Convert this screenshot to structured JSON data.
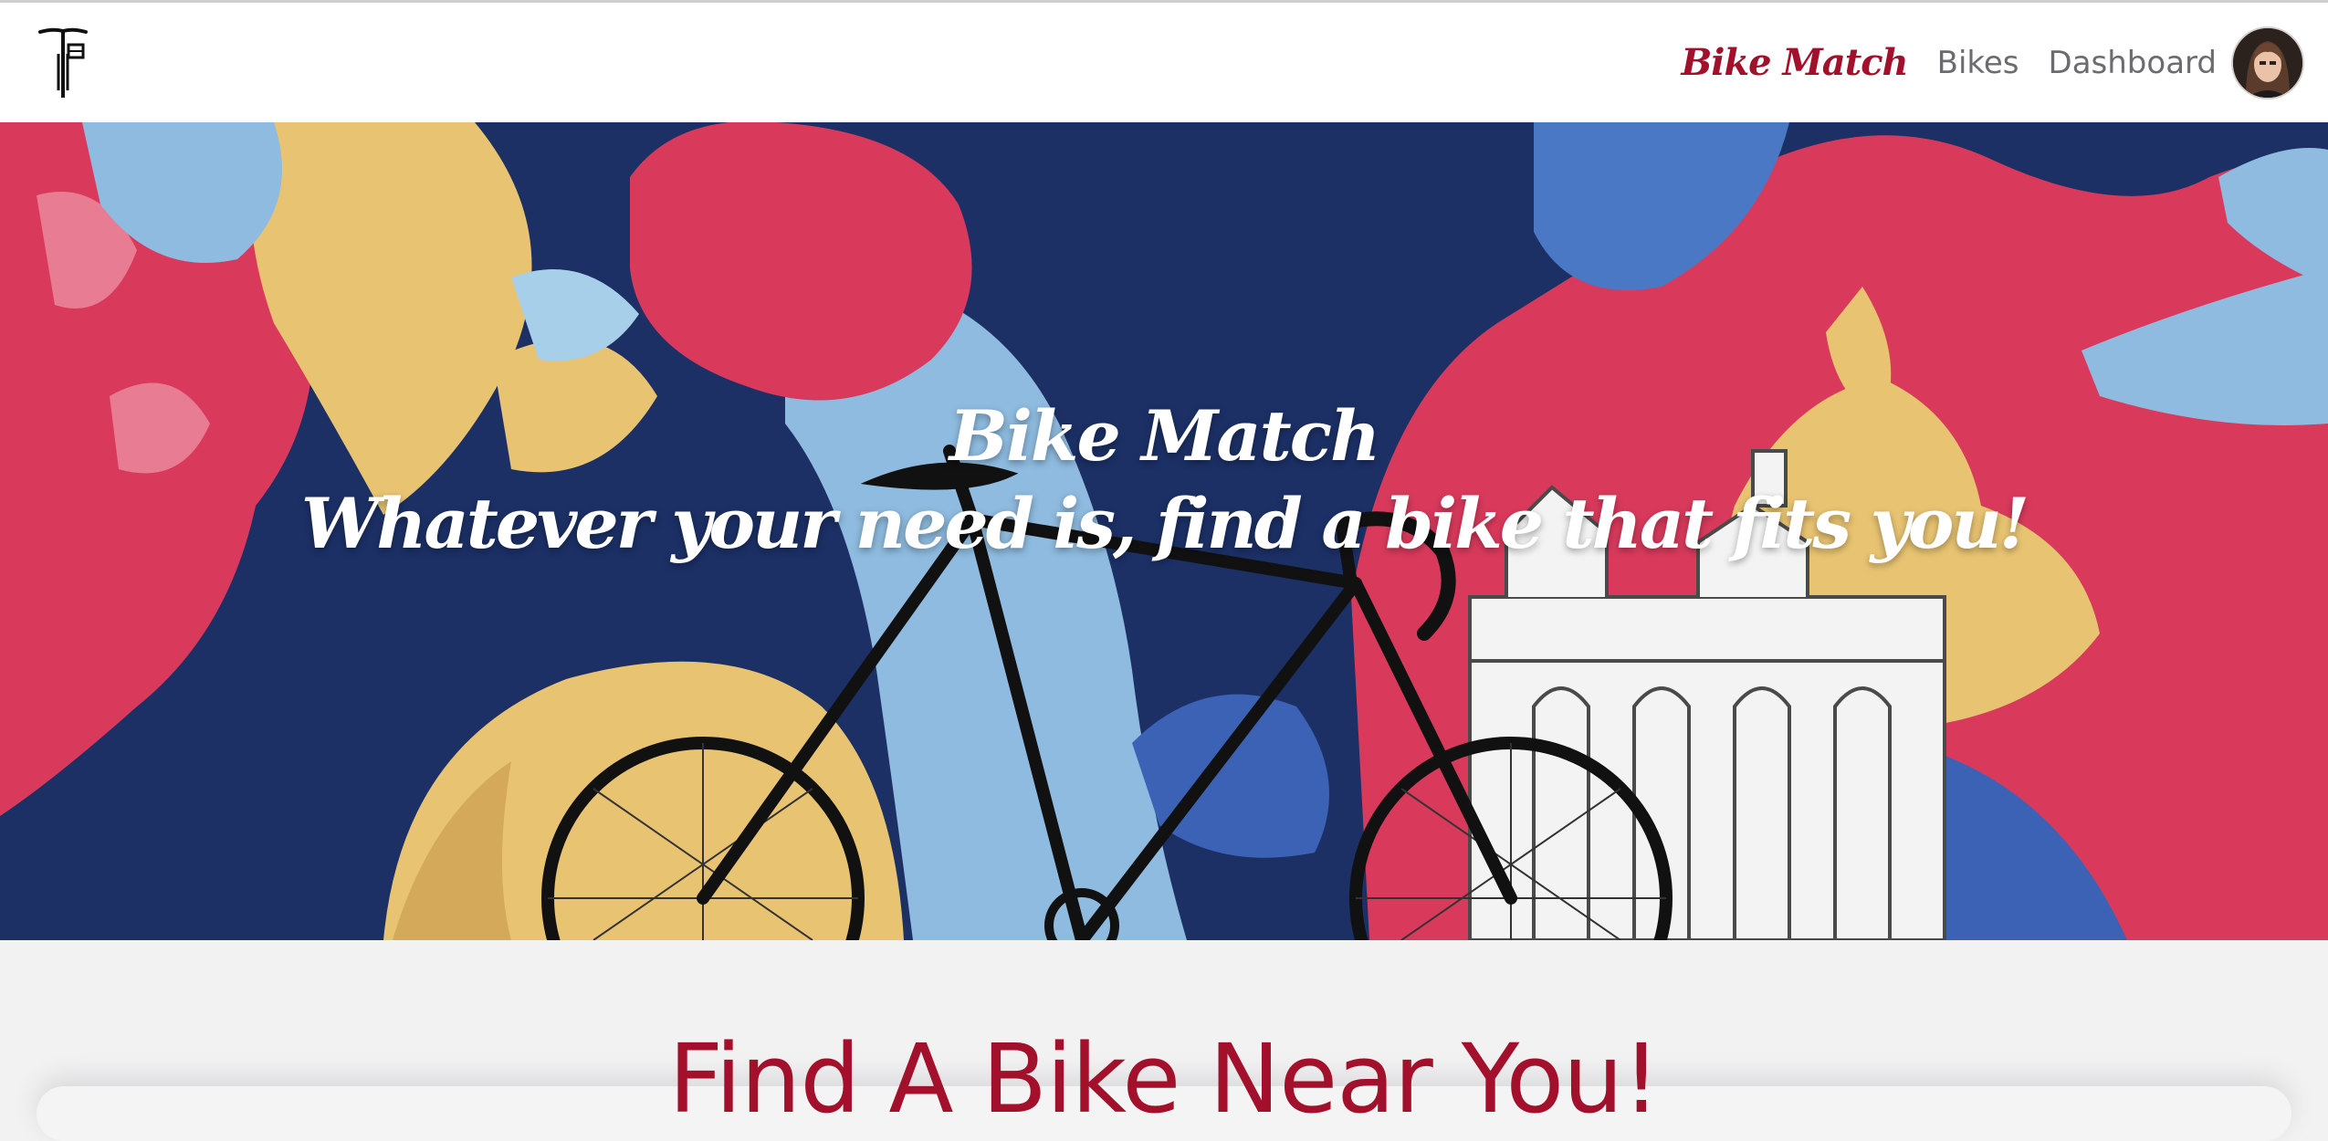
{
  "nav": {
    "brand": "Bike Match",
    "links": [
      "Bikes",
      "Dashboard"
    ]
  },
  "icons": {
    "logo": "bicycle-handlebar-logo",
    "avatar": "user-avatar"
  },
  "hero": {
    "title": "Bike Match",
    "tagline": "Whatever your need is, find a bike that fits you!"
  },
  "section": {
    "title": "Find A Bike Near You!"
  },
  "colors": {
    "accent": "#a3102c",
    "nav_text": "#6b6b70",
    "mural_blue": "#1c3066",
    "mural_red": "#d93a5c",
    "mural_yellow": "#e8c472",
    "mural_lightblue": "#8ebbdf"
  }
}
